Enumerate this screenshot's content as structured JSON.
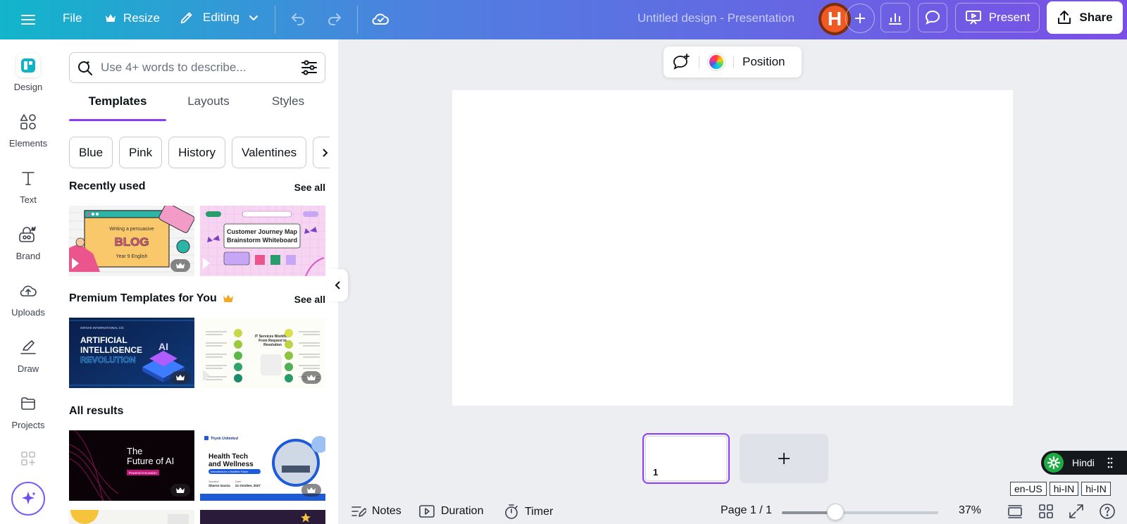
{
  "topbar": {
    "file": "File",
    "resize": "Resize",
    "editing": "Editing",
    "doc_title": "Untitled design - Presentation",
    "avatar_initial": "H",
    "present": "Present",
    "share": "Share"
  },
  "rail": {
    "items": [
      {
        "label": "Design",
        "icon": "design-icon"
      },
      {
        "label": "Elements",
        "icon": "elements-icon"
      },
      {
        "label": "Text",
        "icon": "text-icon"
      },
      {
        "label": "Brand",
        "icon": "brand-icon"
      },
      {
        "label": "Uploads",
        "icon": "uploads-icon"
      },
      {
        "label": "Draw",
        "icon": "draw-icon"
      },
      {
        "label": "Projects",
        "icon": "projects-icon"
      }
    ]
  },
  "panel": {
    "search_placeholder": "Use 4+ words to describe...",
    "tabs": [
      "Templates",
      "Layouts",
      "Styles"
    ],
    "chips": [
      "Blue",
      "Pink",
      "History",
      "Valentines"
    ],
    "recently_used": "Recently used",
    "premium": "Premium Templates for You",
    "all_results": "All results",
    "see_all": "See all",
    "thumbs": {
      "blog": {
        "line1": "Writing a persuasive",
        "title": "BLOG",
        "sub": "Year 9 English"
      },
      "journey": {
        "title1": "Customer Journey Map",
        "title2": "Brainstorm Whiteboard"
      },
      "ai": {
        "brand": "GRAVIS INTERNATIONAL CO.",
        "l1": "ARTIFICIAL",
        "l2": "INTELLIGENCE",
        "l3": "REVOLUTION",
        "badge": "AI"
      },
      "workflow": {
        "title1": "IT Services Workflow",
        "title2": "From Request to",
        "title3": "Resolution"
      },
      "future": {
        "l1": "The",
        "l2": "Future of AI",
        "tag": "Powered Innovation"
      },
      "health": {
        "brand": "Thynk Unlimited",
        "l1": "Health Tech",
        "l2": "and Wellness",
        "tag": "Innovations for a Healthier Future",
        "speaker_label": "Speaker",
        "speaker": "Sharon Garcia",
        "date_label": "Date",
        "date": "21 October, 2027"
      }
    }
  },
  "canvas": {
    "position": "Position",
    "page_number": "1"
  },
  "bottombar": {
    "notes": "Notes",
    "duration": "Duration",
    "timer": "Timer",
    "page": "Page 1 / 1",
    "zoom": "37%",
    "zoom_level": 0.37
  },
  "language": {
    "current": "Hindi",
    "tags": [
      "en-US",
      "hi-IN",
      "hi-IN"
    ]
  },
  "colors": {
    "accent": "#8b3dff",
    "gradient_start": "#12b5cb",
    "gradient_end": "#7b4fe6"
  }
}
